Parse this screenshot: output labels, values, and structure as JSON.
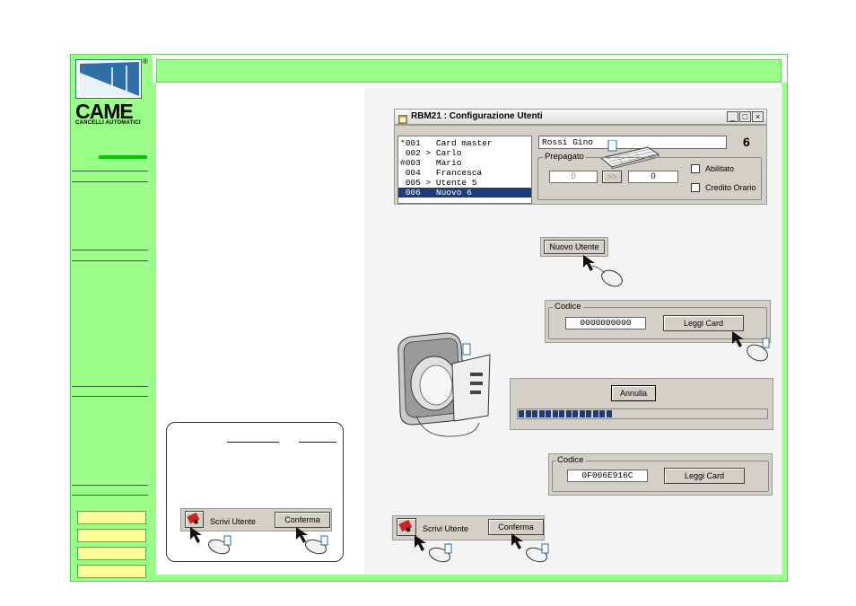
{
  "logo": {
    "word": "CAME",
    "subtitle": "CANCELLI AUTOMATICI",
    "registered": "®"
  },
  "window": {
    "title": "RBM21 : Configurazione Utenti",
    "controls": [
      "_",
      "□",
      "×"
    ],
    "users": [
      "*001   Card master",
      " 002 > Carlo",
      "#003   Mario",
      " 004   Francesca",
      " 005 > Utente 5",
      " 006   Nuovo 6"
    ],
    "selected_index": 5,
    "name_value": "Rossi Gino",
    "user_number": "6",
    "prepagato_label": "Prepagato",
    "credit_value": "0",
    "transfer_label": ">>",
    "second_value": "0",
    "abilitato_label": "Abilitato",
    "credito_orario_label": "Credito Orario"
  },
  "new_user_button": "Nuovo Utente",
  "codice_panel_1": {
    "label": "Codice",
    "value": "0000000000",
    "button": "Leggi Card"
  },
  "cancel_panel": {
    "button": "Annulla",
    "progress_blocks": 14
  },
  "codice_panel_2": {
    "label": "Codice",
    "value": "0F006E916C",
    "button": "Leggi Card"
  },
  "write_bar": {
    "write_label": "Scrivi Utente",
    "confirm_button": "Conferma"
  },
  "inset_write_bar": {
    "write_label": "Scrivi Utente",
    "confirm_button": "Conferma"
  }
}
